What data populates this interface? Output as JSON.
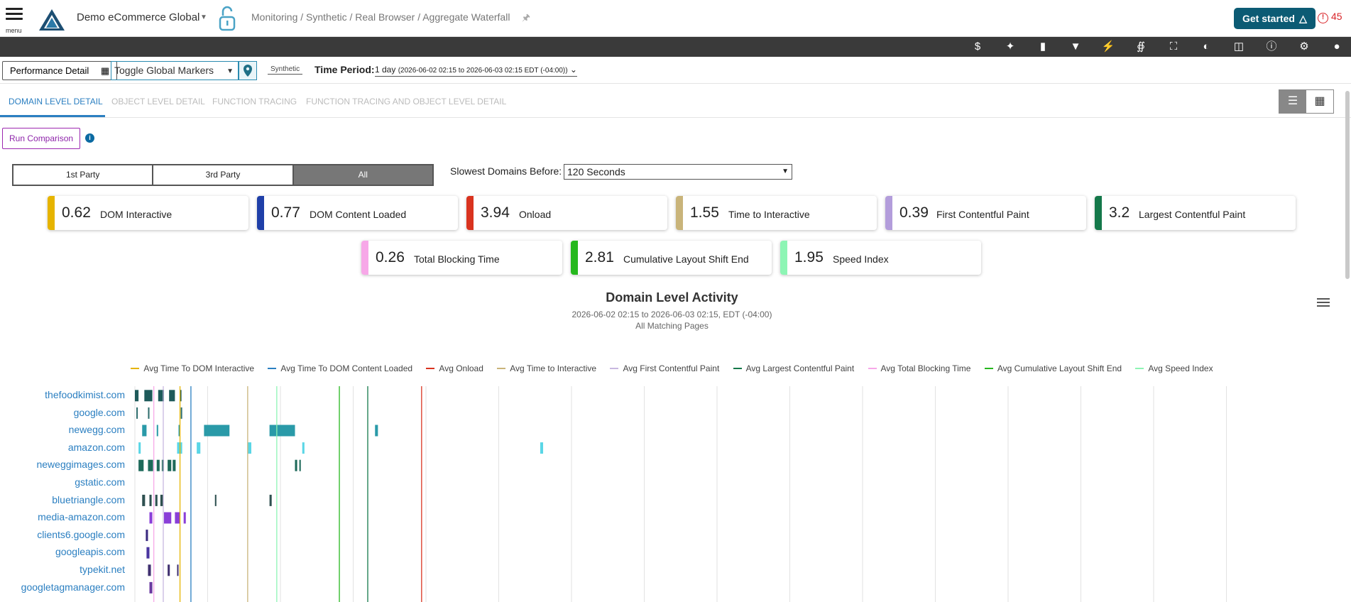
{
  "header": {
    "menu_label": "menu",
    "company": "Demo eCommerce Global",
    "breadcrumb": "Monitoring / Synthetic / Real Browser / Aggregate Waterfall",
    "get_started": "Get started",
    "alert_count": "45"
  },
  "toolbar": {
    "icons": [
      "dollar-icon",
      "sparkle-icon",
      "comment-icon",
      "filter-icon",
      "lightning-icon",
      "share-icon",
      "fullscreen-icon",
      "contrast-icon",
      "columns-icon",
      "help-icon",
      "settings-icon",
      "user-icon"
    ]
  },
  "filters": {
    "performance_detail": "Performance Detail",
    "toggle_markers": "Toggle Global Markers",
    "synthetic": "Synthetic",
    "time_period_label": "Time Period:",
    "time_period_value": "1 day",
    "time_period_range": "(2026-06-02 02:15 to 2026-06-03 02:15 EDT (-04:00))"
  },
  "tabs": [
    {
      "label": "DOMAIN LEVEL DETAIL",
      "active": true
    },
    {
      "label": "OBJECT LEVEL DETAIL",
      "active": false
    },
    {
      "label": "FUNCTION TRACING",
      "active": false
    },
    {
      "label": "FUNCTION TRACING AND OBJECT LEVEL DETAIL",
      "active": false
    }
  ],
  "run_comparison": "Run Comparison",
  "party_toggle": {
    "first": "1st Party",
    "third": "3rd Party",
    "all": "All",
    "selected": "All"
  },
  "slowest": {
    "label": "Slowest Domains Before:",
    "value": "120 Seconds"
  },
  "metrics": [
    {
      "value": "0.62",
      "label": "DOM Interactive",
      "color": "#e6b400"
    },
    {
      "value": "0.77",
      "label": "DOM Content Loaded",
      "color": "#1f3fa8"
    },
    {
      "value": "3.94",
      "label": "Onload",
      "color": "#d9331f"
    },
    {
      "value": "1.55",
      "label": "Time to Interactive",
      "color": "#c9b47a"
    },
    {
      "value": "0.39",
      "label": "First Contentful Paint",
      "color": "#b39ddb"
    },
    {
      "value": "3.2",
      "label": "Largest Contentful Paint",
      "color": "#14784a"
    },
    {
      "value": "0.26",
      "label": "Total Blocking Time",
      "color": "#f7a8e8"
    },
    {
      "value": "2.81",
      "label": "Cumulative Layout Shift End",
      "color": "#26b81e"
    },
    {
      "value": "1.95",
      "label": "Speed Index",
      "color": "#8df5b4"
    }
  ],
  "chart": {
    "title": "Domain Level Activity",
    "subtitle": "2026-06-02 02:15 to 2026-06-03 02:15, EDT (-04:00)",
    "subtitle2": "All Matching Pages",
    "legend": [
      {
        "label": "Avg Time To DOM Interactive",
        "color": "#e6b400"
      },
      {
        "label": "Avg Time To DOM Content Loaded",
        "color": "#2b7fc1"
      },
      {
        "label": "Avg Onload",
        "color": "#d9331f"
      },
      {
        "label": "Avg Time to Interactive",
        "color": "#c9b47a"
      },
      {
        "label": "Avg First Contentful Paint",
        "color": "#c8b8e0"
      },
      {
        "label": "Avg Largest Contentful Paint",
        "color": "#14784a"
      },
      {
        "label": "Avg Total Blocking Time",
        "color": "#f7a8e8"
      },
      {
        "label": "Avg Cumulative Layout Shift End",
        "color": "#26b81e"
      },
      {
        "label": "Avg Speed Index",
        "color": "#8df5b4"
      }
    ]
  },
  "chart_data": {
    "type": "bar",
    "title": "Domain Level Activity",
    "subtitle": "2026-06-02 02:15 to 2026-06-03 02:15, EDT (-04:00)",
    "categories": [
      "thefoodkimist.com",
      "google.com",
      "newegg.com",
      "amazon.com",
      "neweggimages.com",
      "gstatic.com",
      "bluetriangle.com",
      "media-amazon.com",
      "clients6.google.com",
      "googleapis.com",
      "typekit.net",
      "googletagmanager.com"
    ],
    "xlim": [
      0,
      16
    ],
    "markers": [
      {
        "name": "Avg Time To DOM Interactive",
        "value": 0.62,
        "color": "#e6b400"
      },
      {
        "name": "Avg Time To DOM Content Loaded",
        "value": 0.77,
        "color": "#2b7fc1"
      },
      {
        "name": "Avg Onload",
        "value": 3.94,
        "color": "#d9331f"
      },
      {
        "name": "Avg Time to Interactive",
        "value": 1.55,
        "color": "#c9b47a"
      },
      {
        "name": "Avg First Contentful Paint",
        "value": 0.39,
        "color": "#c8b8e0"
      },
      {
        "name": "Avg Largest Contentful Paint",
        "value": 3.2,
        "color": "#14784a"
      },
      {
        "name": "Avg Total Blocking Time",
        "value": 0.26,
        "color": "#f7a8e8"
      },
      {
        "name": "Avg Cumulative Layout Shift End",
        "value": 2.81,
        "color": "#26b81e"
      },
      {
        "name": "Avg Speed Index",
        "value": 1.95,
        "color": "#8df5b4"
      }
    ],
    "series": [
      {
        "domain": "thefoodkimist.com",
        "color": "#1e5a5a",
        "segments": [
          [
            0.0,
            0.05
          ],
          [
            0.13,
            0.24
          ],
          [
            0.32,
            0.4
          ],
          [
            0.47,
            0.55
          ],
          [
            0.62,
            0.64
          ]
        ]
      },
      {
        "domain": "google.com",
        "color": "#2e6d6d",
        "segments": [
          [
            0.02,
            0.04
          ],
          [
            0.18,
            0.2
          ],
          [
            0.63,
            0.65
          ]
        ]
      },
      {
        "domain": "newegg.com",
        "color": "#2a9aa8",
        "segments": [
          [
            0.1,
            0.16
          ],
          [
            0.3,
            0.32
          ],
          [
            0.6,
            0.62
          ],
          [
            0.95,
            1.3
          ],
          [
            1.85,
            2.2
          ],
          [
            3.3,
            3.34
          ]
        ]
      },
      {
        "domain": "amazon.com",
        "color": "#5ad6e6",
        "segments": [
          [
            0.05,
            0.08
          ],
          [
            0.58,
            0.65
          ],
          [
            0.85,
            0.9
          ],
          [
            1.55,
            1.6
          ],
          [
            2.3,
            2.33
          ],
          [
            5.57,
            5.61
          ]
        ]
      },
      {
        "domain": "neweggimages.com",
        "color": "#1e6a5a",
        "segments": [
          [
            0.05,
            0.12
          ],
          [
            0.18,
            0.25
          ],
          [
            0.3,
            0.34
          ],
          [
            0.37,
            0.4
          ],
          [
            0.45,
            0.5
          ],
          [
            0.52,
            0.56
          ],
          [
            2.2,
            2.23
          ],
          [
            2.26,
            2.28
          ]
        ]
      },
      {
        "domain": "gstatic.com",
        "color": "#2e6d6d",
        "segments": []
      },
      {
        "domain": "bluetriangle.com",
        "color": "#2e5050",
        "segments": [
          [
            0.1,
            0.14
          ],
          [
            0.2,
            0.23
          ],
          [
            0.28,
            0.31
          ],
          [
            0.35,
            0.39
          ],
          [
            1.1,
            1.12
          ],
          [
            1.85,
            1.88
          ]
        ]
      },
      {
        "domain": "media-amazon.com",
        "color": "#8a3fd8",
        "segments": [
          [
            0.2,
            0.24
          ],
          [
            0.4,
            0.5
          ],
          [
            0.55,
            0.62
          ],
          [
            0.67,
            0.7
          ]
        ]
      },
      {
        "domain": "clients6.google.com",
        "color": "#3a2a80",
        "segments": [
          [
            0.15,
            0.18
          ]
        ]
      },
      {
        "domain": "googleapis.com",
        "color": "#4a35a0",
        "segments": [
          [
            0.16,
            0.2
          ]
        ]
      },
      {
        "domain": "typekit.net",
        "color": "#403070",
        "segments": [
          [
            0.18,
            0.22
          ],
          [
            0.45,
            0.48
          ],
          [
            0.58,
            0.6
          ]
        ]
      },
      {
        "domain": "googletagmanager.com",
        "color": "#6a3aa0",
        "segments": [
          [
            0.2,
            0.24
          ]
        ]
      }
    ]
  }
}
